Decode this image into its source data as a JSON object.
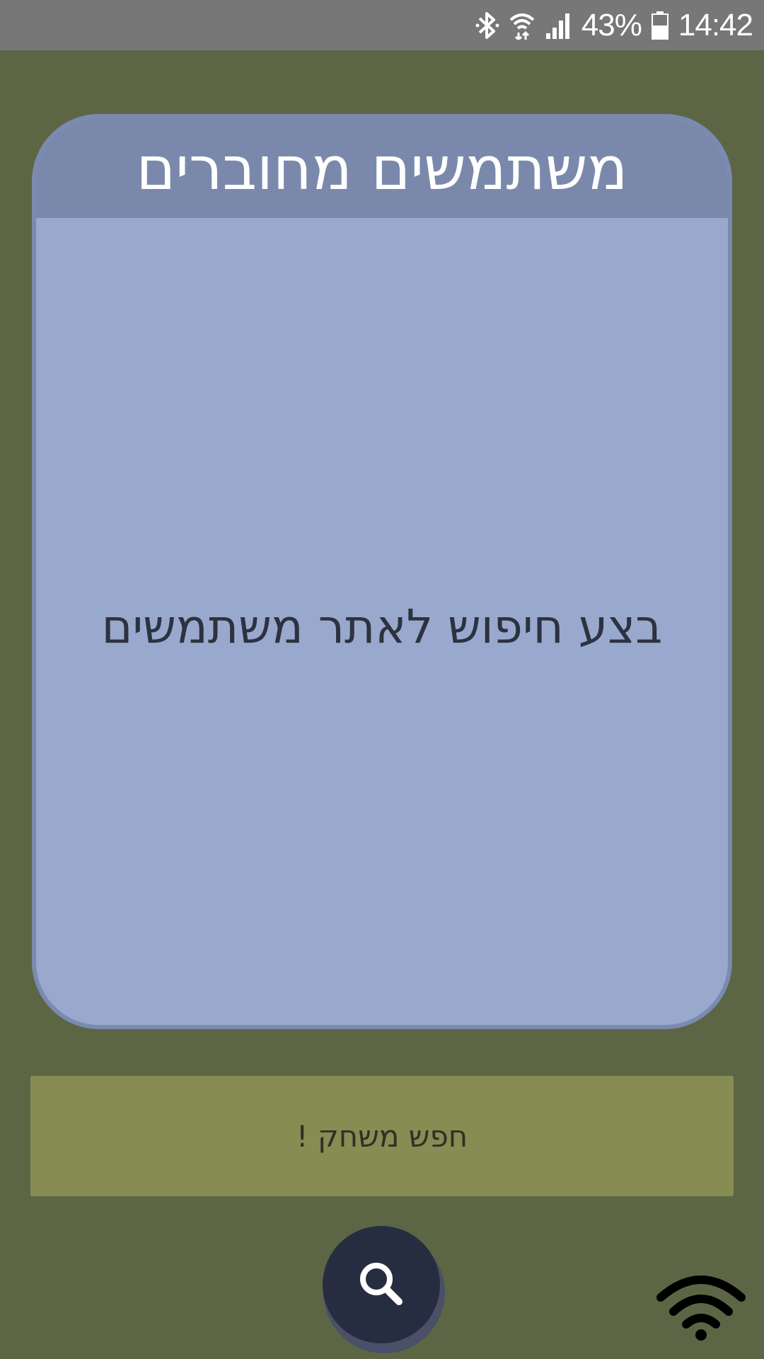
{
  "status_bar": {
    "battery_percent": "43%",
    "time": "14:42",
    "icons": [
      "bluetooth-icon",
      "wifi-data-icon",
      "signal-icon",
      "battery-icon"
    ]
  },
  "card": {
    "title": "משתמשים מחוברים",
    "empty_message": "בצע חיפוש לאתר משתמשים"
  },
  "find_game_button": {
    "label": "חפש משחק !"
  },
  "fab": {
    "icon": "search-icon"
  },
  "connection": {
    "icon": "wifi-icon"
  },
  "colors": {
    "background": "#5c6645",
    "card_header": "#7a89ab",
    "card_body": "#99a9cd",
    "button": "#878c53",
    "fab": "#272d40"
  }
}
